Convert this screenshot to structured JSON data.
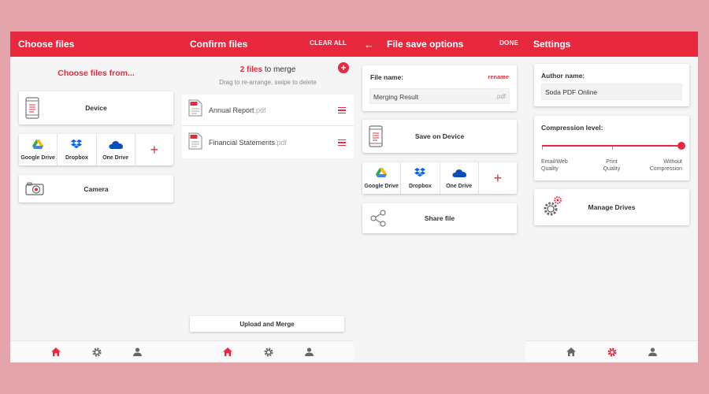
{
  "colors": {
    "accent": "#e8283d",
    "background": "#e3a4ac"
  },
  "screen1": {
    "title": "Choose files",
    "heading": "Choose files from...",
    "device_label": "Device",
    "clouds": [
      "Google Drive",
      "Dropbox",
      "One Drive"
    ],
    "add_symbol": "+",
    "camera_label": "Camera"
  },
  "screen2": {
    "title": "Confirm files",
    "action": "CLEAR ALL",
    "count_strong": "2 files",
    "count_rest": " to merge",
    "hint": "Drag to re-arrange, swipe to delete",
    "files": [
      {
        "name": "Annual Report",
        "ext": ".pdf"
      },
      {
        "name": "Financial Statements",
        "ext": ".pdf"
      }
    ],
    "pdf_badge": "PDF",
    "upload_label": "Upload and Merge",
    "add_symbol": "+"
  },
  "screen3": {
    "title": "File save options",
    "action": "DONE",
    "back_symbol": "←",
    "file_name_label": "File name:",
    "rename_label": "rename",
    "file_name_value": "Merging Result",
    "file_ext": ".pdf",
    "save_device_label": "Save on Device",
    "clouds": [
      "Google Drive",
      "Dropbox",
      "One Drive"
    ],
    "add_symbol": "+",
    "share_label": "Share file"
  },
  "screen4": {
    "title": "Settings",
    "author_label": "Author name:",
    "author_value": "Soda PDF Online",
    "compression_label": "Compression level:",
    "compression_level": 1.0,
    "levels": [
      {
        "l1": "Email/Web",
        "l2": "Quality"
      },
      {
        "l1": "Print",
        "l2": "Quality"
      },
      {
        "l1": "Without",
        "l2": "Compression"
      }
    ],
    "manage_drives_label": "Manage Drives"
  }
}
